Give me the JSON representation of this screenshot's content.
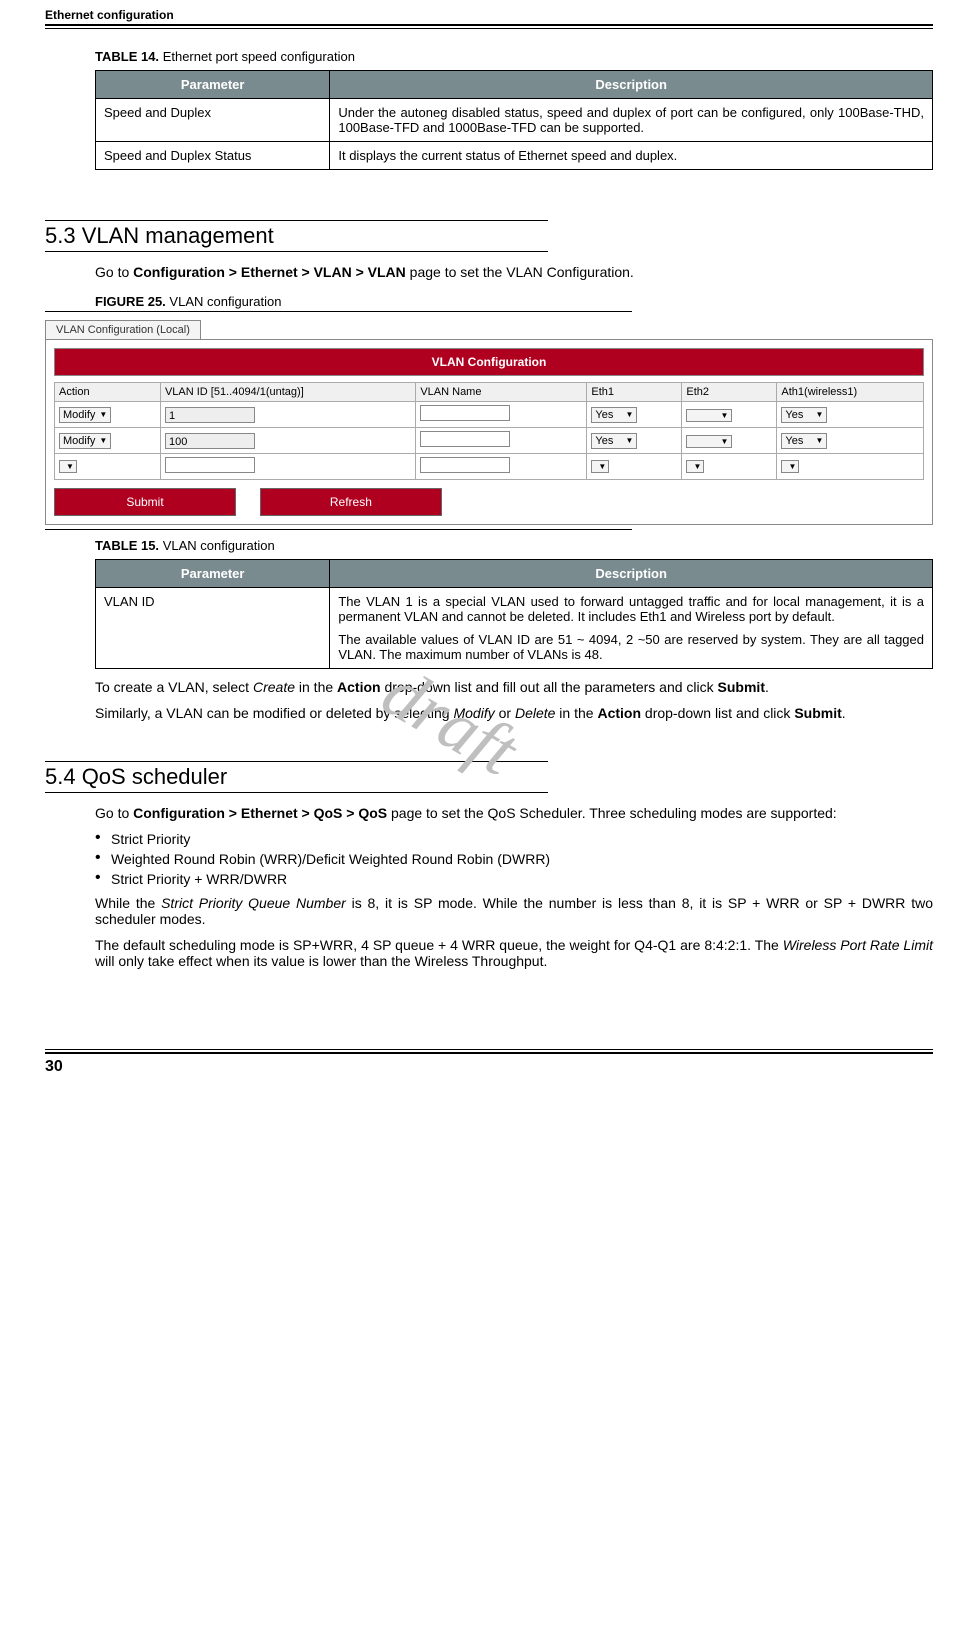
{
  "running_head": "Ethernet configuration",
  "page_number": "30",
  "watermark": "draft",
  "table14": {
    "caption_label": "TABLE 14.",
    "caption_text": "Ethernet port speed configuration",
    "headers": {
      "param": "Parameter",
      "desc": "Description"
    },
    "rows": [
      {
        "param": "Speed and Duplex",
        "desc": "Under the autoneg disabled status, speed and duplex of port can be configured, only 100Base-THD, 100Base-TFD and 1000Base-TFD can be supported."
      },
      {
        "param": "Speed and Duplex Status",
        "desc": "It displays the current status of Ethernet speed and duplex."
      }
    ]
  },
  "section53": {
    "title": "5.3 VLAN management",
    "intro_pre": "Go to ",
    "intro_bold": "Configuration > Ethernet > VLAN > VLAN",
    "intro_post": " page to set the VLAN Configuration.",
    "fig_label": "FIGURE 25.",
    "fig_text": "VLAN configuration"
  },
  "vlan_mock": {
    "tab": "VLAN Configuration (Local)",
    "banner": "VLAN Configuration",
    "cols": {
      "action": "Action",
      "vlanid": "VLAN ID [51..4094/1(untag)]",
      "vlanname": "VLAN Name",
      "eth1": "Eth1",
      "eth2": "Eth2",
      "ath1": "Ath1(wireless1)"
    },
    "rows": [
      {
        "action": "Modify",
        "vlanid": "1",
        "vlanname": "",
        "eth1": "Yes",
        "eth2": "",
        "ath1": "Yes"
      },
      {
        "action": "Modify",
        "vlanid": "100",
        "vlanname": "",
        "eth1": "Yes",
        "eth2": "",
        "ath1": "Yes"
      },
      {
        "action": "",
        "vlanid": "",
        "vlanname": "",
        "eth1": "",
        "eth2": "",
        "ath1": ""
      }
    ],
    "buttons": {
      "submit": "Submit",
      "refresh": "Refresh"
    }
  },
  "table15": {
    "caption_label": "TABLE 15.",
    "caption_text": "VLAN configuration",
    "headers": {
      "param": "Parameter",
      "desc": "Description"
    },
    "row": {
      "param": "VLAN ID",
      "desc1": "The VLAN 1 is a special VLAN used to forward untagged traffic and for local management, it is a permanent VLAN and cannot be deleted. It includes Eth1 and Wireless port by default.",
      "desc2": "The available values of VLAN ID are 51 ~ 4094, 2 ~50 are reserved by system. They are all tagged VLAN. The maximum number of VLANs is 48."
    }
  },
  "para_create": {
    "p1a": "To create a VLAN, select ",
    "p1_it1": "Create",
    "p1b": " in the ",
    "p1_bold1": "Action",
    "p1c": " drop-down list and fill out all the parameters and click ",
    "p1_bold2": "Submit",
    "p1d": "."
  },
  "para_modify": {
    "p2a": "Similarly, a VLAN can be modified or deleted by selecting ",
    "p2_it1": "Modify",
    "p2b": " or ",
    "p2_it2": "Delete",
    "p2c": " in the ",
    "p2_bold1": "Action",
    "p2d": " drop-down list and click ",
    "p2_bold2": "Submit",
    "p2e": "."
  },
  "section54": {
    "title": "5.4 QoS scheduler",
    "intro_pre": "Go to ",
    "intro_bold": "Configuration > Ethernet > QoS > QoS",
    "intro_post": " page to set the QoS Scheduler.  Three scheduling modes are supported:",
    "bullets": [
      "Strict Priority",
      "Weighted Round Robin (WRR)/Deficit Weighted Round Robin (DWRR)",
      "Strict Priority + WRR/DWRR"
    ],
    "p_after1a": "While the ",
    "p_after1_it": "Strict Priority Queue Number",
    "p_after1b": " is 8, it is SP mode. While the number is less than 8, it is SP + WRR or SP + DWRR two scheduler modes.",
    "p_after2a": "The default scheduling mode is SP+WRR, 4 SP queue + 4 WRR queue, the weight for Q4-Q1 are 8:4:2:1. The ",
    "p_after2_it": "Wireless Port Rate Limit",
    "p_after2b": " will only take effect when its value is lower than the Wireless Throughput."
  }
}
